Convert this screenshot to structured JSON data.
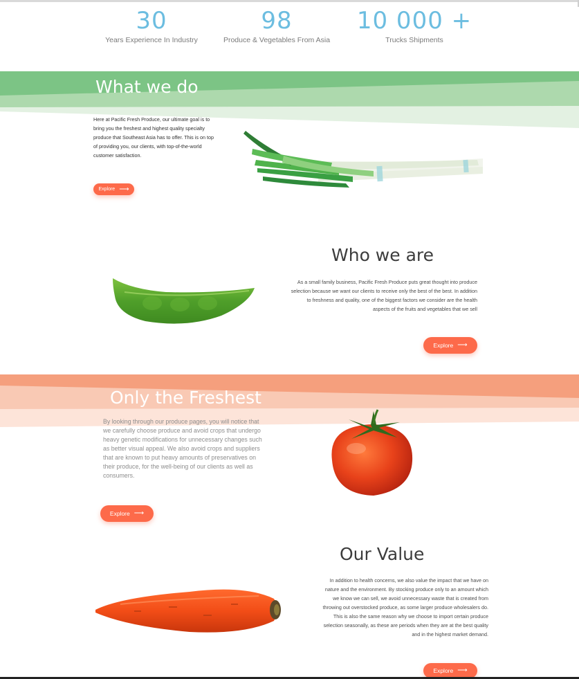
{
  "stats": [
    {
      "number": "30",
      "label": "Years Experience In Industry"
    },
    {
      "number": "98",
      "label": "Produce & Vegetables From Asia"
    },
    {
      "number": "10 000 +",
      "label": "Trucks Shipments"
    }
  ],
  "sections": {
    "what_we_do": {
      "title": "What we do",
      "text": "Here at Pacific Fresh Produce, our ultimate goal is to bring you the freshest and highest quality specialty produce that Southeast Asia has to offer. This is on top of providing you, our clients, with top-of-the-world customer satisfaction.",
      "button": "Explore",
      "image": "green-onion-image"
    },
    "who_we_are": {
      "title": "Who we are",
      "text": "As a small family business, Pacific Fresh Produce puts great thought into produce selection because we want our clients to receive only the best of the best. In addition to freshness and quality, one of the biggest factors we consider are the health aspects of the fruits and vegetables that we sell",
      "button": "Explore",
      "image": "snow-pea-image"
    },
    "only_the_freshest": {
      "title": "Only the Freshest",
      "text": "By looking through our produce pages, you will notice that we carefully choose produce and avoid crops that undergo heavy genetic modifications for unnecessary changes such as better visual appeal. We also avoid crops and suppliers that are known to put heavy amounts of preservatives on their produce, for the well-being of our clients as well as consumers.",
      "button": "Explore",
      "image": "tomato-image"
    },
    "our_value": {
      "title": "Our Value",
      "text": "In addition to health concerns, we also value the impact that we have on nature and the environment. By stocking produce only to an amount which we know we can sell, we avoid unnecessary waste that is created from throwing out overstocked produce, as some larger produce wholesalers do. This is also the same reason why we choose to import certain produce selection seasonally, as these are periods when they are at the best quality and in the highest market demand.",
      "button": "Explore",
      "image": "carrot-image"
    }
  },
  "colors": {
    "accent_blue": "#6cbde0",
    "green_band": "#7cc485",
    "orange_band": "#f59f7d",
    "button": "#fd6a4a"
  },
  "icons": {
    "button_arrow": "arrow-right-icon"
  }
}
